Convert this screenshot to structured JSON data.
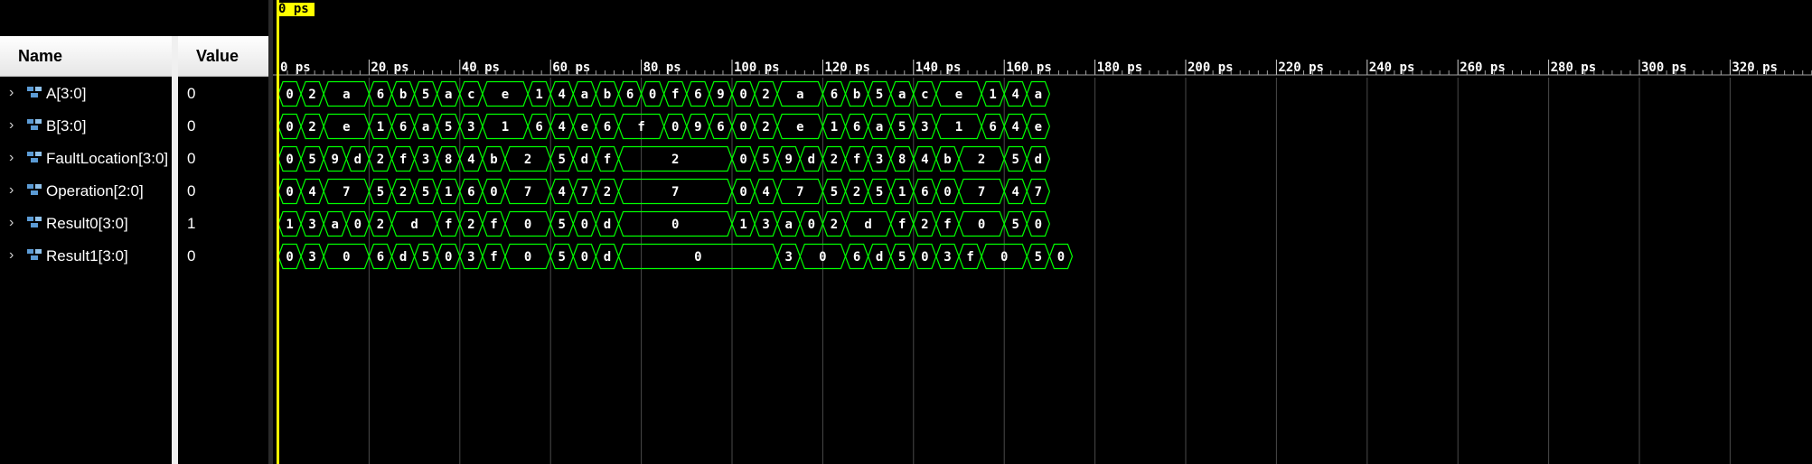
{
  "header": {
    "name_label": "Name",
    "value_label": "Value"
  },
  "cursor": {
    "label": "0 ps"
  },
  "timeline": {
    "ticks": [
      "0 ps",
      "20 ps",
      "40 ps",
      "60 ps",
      "80 ps",
      "100 ps",
      "120 ps",
      "140 ps",
      "160 ps",
      "180 ps",
      "200 ps",
      "220 ps",
      "240 ps",
      "260 ps",
      "280 ps",
      "300 ps",
      "320 ps"
    ]
  },
  "colors": {
    "wave": "#00ff00",
    "cursor": "#ffff00",
    "background": "#000000",
    "grid": "#4a4a4a"
  },
  "signals": [
    {
      "name": "A[3:0]",
      "value": "0",
      "segments": [
        [
          "0",
          5
        ],
        [
          "2",
          5
        ],
        [
          "a",
          10
        ],
        [
          "6",
          5
        ],
        [
          "b",
          5
        ],
        [
          "5",
          5
        ],
        [
          "a",
          5
        ],
        [
          "c",
          5
        ],
        [
          "e",
          10
        ],
        [
          "1",
          5
        ],
        [
          "4",
          5
        ],
        [
          "a",
          5
        ],
        [
          "b",
          5
        ],
        [
          "6",
          5
        ],
        [
          "0",
          5
        ],
        [
          "f",
          5
        ],
        [
          "6",
          5
        ],
        [
          "9",
          5
        ],
        [
          "0",
          5
        ],
        [
          "2",
          5
        ],
        [
          "a",
          10
        ],
        [
          "6",
          5
        ],
        [
          "b",
          5
        ],
        [
          "5",
          5
        ],
        [
          "a",
          5
        ],
        [
          "c",
          5
        ],
        [
          "e",
          10
        ],
        [
          "1",
          5
        ],
        [
          "4",
          5
        ],
        [
          "a",
          5
        ]
      ]
    },
    {
      "name": "B[3:0]",
      "value": "0",
      "segments": [
        [
          "0",
          5
        ],
        [
          "2",
          5
        ],
        [
          "e",
          10
        ],
        [
          "1",
          5
        ],
        [
          "6",
          5
        ],
        [
          "a",
          5
        ],
        [
          "5",
          5
        ],
        [
          "3",
          5
        ],
        [
          "1",
          10
        ],
        [
          "6",
          5
        ],
        [
          "4",
          5
        ],
        [
          "e",
          5
        ],
        [
          "6",
          5
        ],
        [
          "f",
          10
        ],
        [
          "0",
          5
        ],
        [
          "9",
          5
        ],
        [
          "6",
          5
        ],
        [
          "0",
          5
        ],
        [
          "2",
          5
        ],
        [
          "e",
          10
        ],
        [
          "1",
          5
        ],
        [
          "6",
          5
        ],
        [
          "a",
          5
        ],
        [
          "5",
          5
        ],
        [
          "3",
          5
        ],
        [
          "1",
          10
        ],
        [
          "6",
          5
        ],
        [
          "4",
          5
        ],
        [
          "e",
          5
        ]
      ]
    },
    {
      "name": "FaultLocation[3:0]",
      "value": "0",
      "segments": [
        [
          "0",
          5
        ],
        [
          "5",
          5
        ],
        [
          "9",
          5
        ],
        [
          "d",
          5
        ],
        [
          "2",
          5
        ],
        [
          "f",
          5
        ],
        [
          "3",
          5
        ],
        [
          "8",
          5
        ],
        [
          "4",
          5
        ],
        [
          "b",
          5
        ],
        [
          "2",
          10
        ],
        [
          "5",
          5
        ],
        [
          "d",
          5
        ],
        [
          "f",
          5
        ],
        [
          "2",
          25
        ],
        [
          "0",
          5
        ],
        [
          "5",
          5
        ],
        [
          "9",
          5
        ],
        [
          "d",
          5
        ],
        [
          "2",
          5
        ],
        [
          "f",
          5
        ],
        [
          "3",
          5
        ],
        [
          "8",
          5
        ],
        [
          "4",
          5
        ],
        [
          "b",
          5
        ],
        [
          "2",
          10
        ],
        [
          "5",
          5
        ],
        [
          "d",
          5
        ]
      ]
    },
    {
      "name": "Operation[2:0]",
      "value": "0",
      "segments": [
        [
          "0",
          5
        ],
        [
          "4",
          5
        ],
        [
          "7",
          10
        ],
        [
          "5",
          5
        ],
        [
          "2",
          5
        ],
        [
          "5",
          5
        ],
        [
          "1",
          5
        ],
        [
          "6",
          5
        ],
        [
          "0",
          5
        ],
        [
          "7",
          10
        ],
        [
          "4",
          5
        ],
        [
          "7",
          5
        ],
        [
          "2",
          5
        ],
        [
          "7",
          25
        ],
        [
          "0",
          5
        ],
        [
          "4",
          5
        ],
        [
          "7",
          10
        ],
        [
          "5",
          5
        ],
        [
          "2",
          5
        ],
        [
          "5",
          5
        ],
        [
          "1",
          5
        ],
        [
          "6",
          5
        ],
        [
          "0",
          5
        ],
        [
          "7",
          10
        ],
        [
          "4",
          5
        ],
        [
          "7",
          5
        ]
      ]
    },
    {
      "name": "Result0[3:0]",
      "value": "1",
      "segments": [
        [
          "1",
          5
        ],
        [
          "3",
          5
        ],
        [
          "a",
          5
        ],
        [
          "0",
          5
        ],
        [
          "2",
          5
        ],
        [
          "d",
          10
        ],
        [
          "f",
          5
        ],
        [
          "2",
          5
        ],
        [
          "f",
          5
        ],
        [
          "0",
          10
        ],
        [
          "5",
          5
        ],
        [
          "0",
          5
        ],
        [
          "d",
          5
        ],
        [
          "0",
          25
        ],
        [
          "1",
          5
        ],
        [
          "3",
          5
        ],
        [
          "a",
          5
        ],
        [
          "0",
          5
        ],
        [
          "2",
          5
        ],
        [
          "d",
          10
        ],
        [
          "f",
          5
        ],
        [
          "2",
          5
        ],
        [
          "f",
          5
        ],
        [
          "0",
          10
        ],
        [
          "5",
          5
        ],
        [
          "0",
          5
        ]
      ]
    },
    {
      "name": "Result1[3:0]",
      "value": "0",
      "segments": [
        [
          "0",
          5
        ],
        [
          "3",
          5
        ],
        [
          "0",
          10
        ],
        [
          "6",
          5
        ],
        [
          "d",
          5
        ],
        [
          "5",
          5
        ],
        [
          "0",
          5
        ],
        [
          "3",
          5
        ],
        [
          "f",
          5
        ],
        [
          "0",
          10
        ],
        [
          "5",
          5
        ],
        [
          "0",
          5
        ],
        [
          "d",
          5
        ],
        [
          "0",
          35
        ],
        [
          "3",
          5
        ],
        [
          "0",
          10
        ],
        [
          "6",
          5
        ],
        [
          "d",
          5
        ],
        [
          "5",
          5
        ],
        [
          "0",
          5
        ],
        [
          "3",
          5
        ],
        [
          "f",
          5
        ],
        [
          "0",
          10
        ],
        [
          "5",
          5
        ],
        [
          "0",
          5
        ]
      ]
    }
  ]
}
